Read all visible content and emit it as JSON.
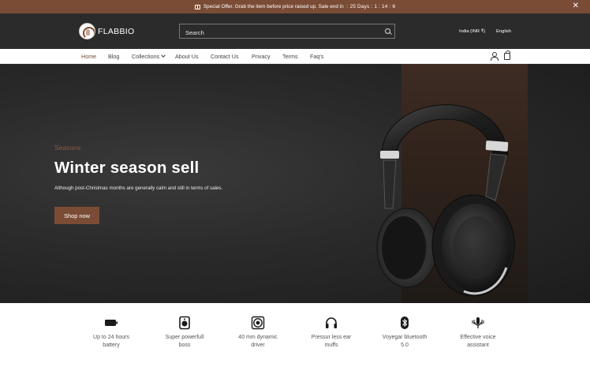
{
  "announcement": {
    "text": "Special Offer. Grab the item before price raised up. Sale end in",
    "timer": ": 25 Days : 1 : 14 : 6",
    "close": "✕"
  },
  "header": {
    "logo_text": "FLABBIO",
    "search_placeholder": "Search",
    "locale": "India (INR ₹)",
    "language": "English"
  },
  "nav": {
    "items": [
      "Home",
      "Blog",
      "Collections",
      "About Us",
      "Contact Us",
      "Privacy",
      "Terms",
      "Faq's"
    ],
    "active": "Home"
  },
  "hero": {
    "kicker": "Seasons",
    "title": "Winter season sell",
    "description": "Although post-Christmas months are generally calm and still in terms of sales.",
    "cta": "Shop now"
  },
  "features": [
    {
      "icon": "battery-icon",
      "line1": "Up to 24 hours",
      "line2": "battery"
    },
    {
      "icon": "speaker-icon",
      "line1": "Super powerfull",
      "line2": "boss"
    },
    {
      "icon": "driver-icon",
      "line1": "40 mm dynamic",
      "line2": "driver"
    },
    {
      "icon": "headphones-icon",
      "line1": "Pressur less ear",
      "line2": "muffs"
    },
    {
      "icon": "bluetooth-icon",
      "line1": "Voyegar bluetooth",
      "line2": "5.0"
    },
    {
      "icon": "microphone-icon",
      "line1": "Effective voice",
      "line2": "assistant"
    }
  ],
  "colors": {
    "accent": "#7b4c35",
    "header_bg": "#2b2b2b",
    "hero_bg": "#262626"
  }
}
